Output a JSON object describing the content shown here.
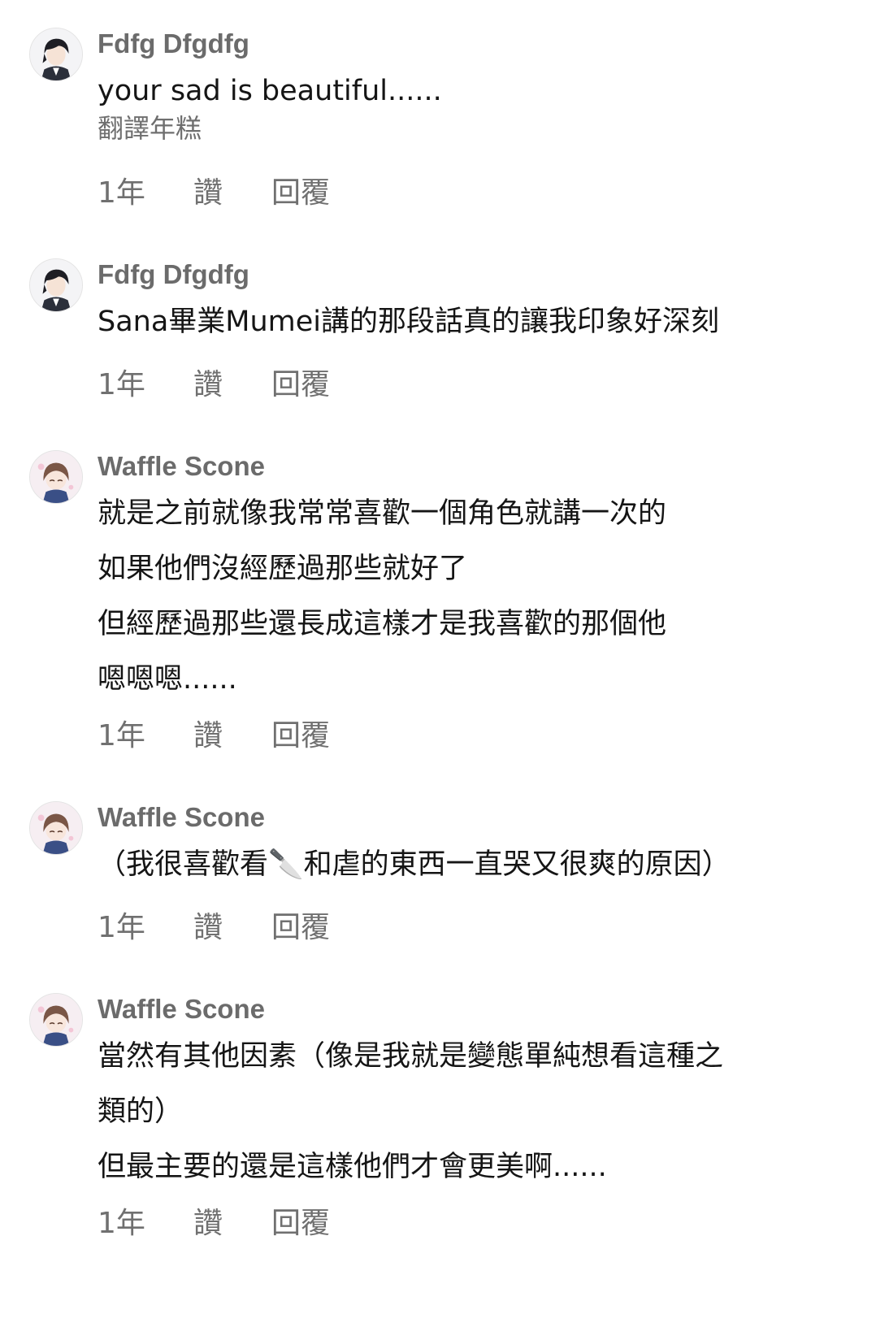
{
  "comments": [
    {
      "author": "Fdfg Dfgdfg",
      "avatar_icon": "dark-hair-boy-avatar-icon",
      "lines": [
        "your sad is beautiful......"
      ],
      "translate": "翻譯年糕",
      "time": "1年",
      "like_label": "讚",
      "reply_label": "回覆"
    },
    {
      "author": "Fdfg Dfgdfg",
      "avatar_icon": "dark-hair-boy-avatar-icon",
      "lines": [
        "Sana畢業Mumei講的那段話真的讓我印象好深刻"
      ],
      "time": "1年",
      "like_label": "讚",
      "reply_label": "回覆"
    },
    {
      "author": "Waffle Scone",
      "avatar_icon": "brown-hair-chibi-avatar-icon",
      "lines": [
        "就是之前就像我常常喜歡一個角色就講一次的",
        "如果他們沒經歷過那些就好了",
        "但經歷過那些還長成這樣才是我喜歡的那個他",
        "嗯嗯嗯......"
      ],
      "time": "1年",
      "like_label": "讚",
      "reply_label": "回覆"
    },
    {
      "author": "Waffle Scone",
      "avatar_icon": "brown-hair-chibi-avatar-icon",
      "lines": [
        "（我很喜歡看🔪和虐的東西一直哭又很爽的原因）"
      ],
      "time": "1年",
      "like_label": "讚",
      "reply_label": "回覆"
    },
    {
      "author": "Waffle Scone",
      "avatar_icon": "brown-hair-chibi-avatar-icon",
      "lines": [
        "當然有其他因素（像是我就是變態單純想看這種之",
        "類的）",
        "但最主要的還是這樣他們才會更美啊......"
      ],
      "time": "1年",
      "like_label": "讚",
      "reply_label": "回覆"
    }
  ]
}
